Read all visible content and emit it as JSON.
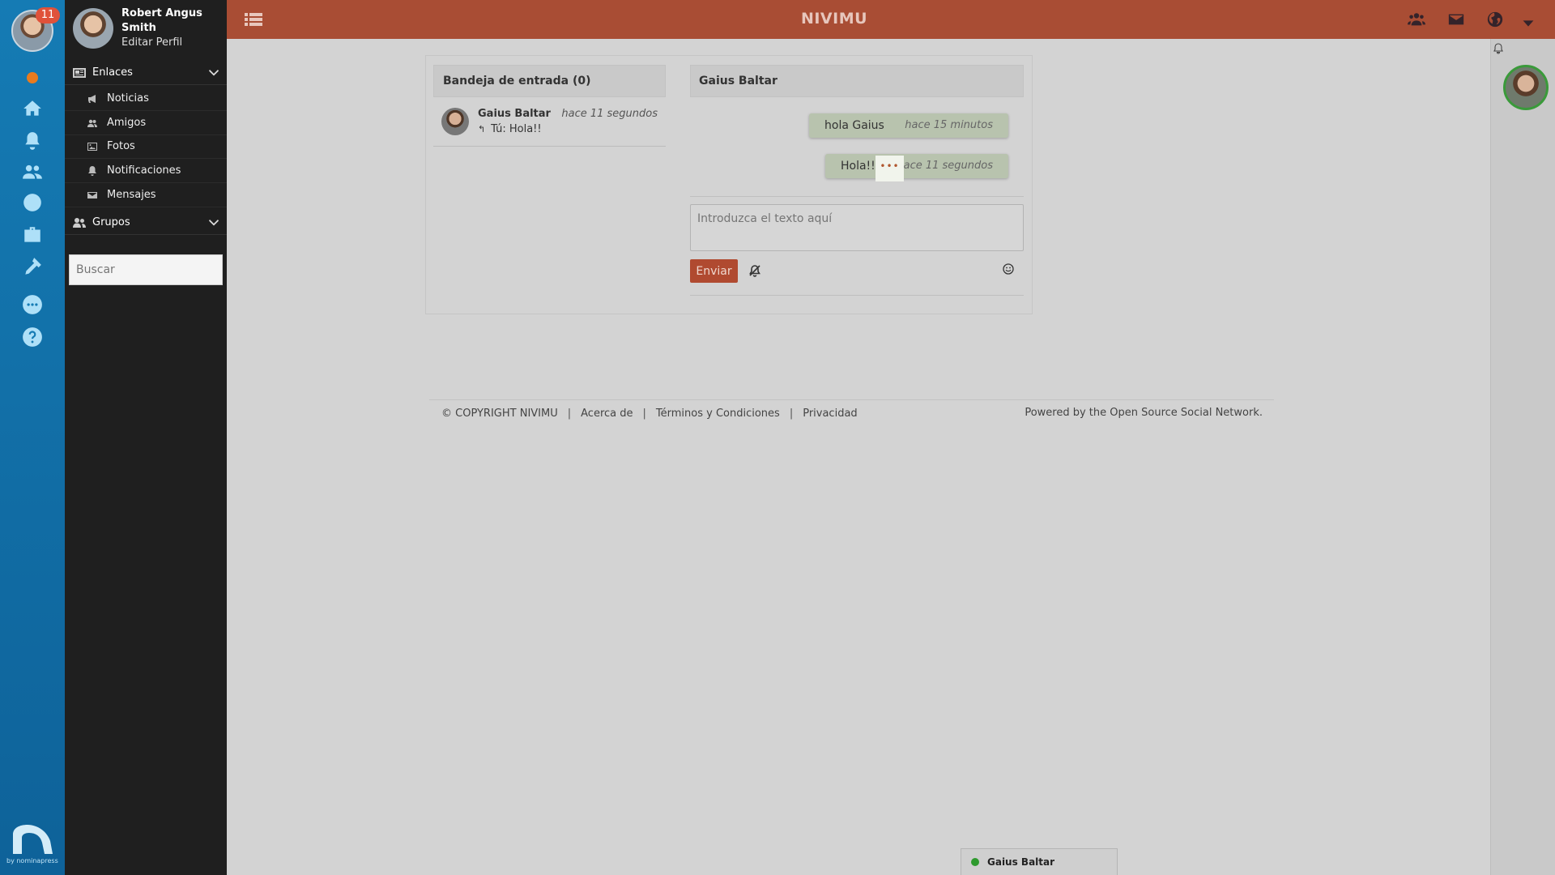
{
  "app": {
    "title": "NIVIMU"
  },
  "rail": {
    "notification_count": "11",
    "brand_by": "by nominapress"
  },
  "user": {
    "name": "Robert Angus Smith",
    "edit_profile": "Editar Perfil"
  },
  "sidebar": {
    "links_section": "Enlaces",
    "items": [
      {
        "label": "Noticias",
        "icon": "megaphone-icon"
      },
      {
        "label": "Amigos",
        "icon": "users-icon"
      },
      {
        "label": "Fotos",
        "icon": "image-icon"
      },
      {
        "label": "Notificaciones",
        "icon": "bell-icon"
      },
      {
        "label": "Mensajes",
        "icon": "envelope-icon"
      }
    ],
    "groups_section": "Grupos",
    "search_placeholder": "Buscar"
  },
  "inbox": {
    "title": "Bandeja de entrada (0)",
    "conversations": [
      {
        "name": "Gaius Baltar",
        "time": "hace 11 segundos",
        "preview": "Tú: Hola!!"
      }
    ]
  },
  "chat": {
    "contact": "Gaius Baltar",
    "messages": [
      {
        "text": "hola Gaius",
        "time": "hace 15 minutos"
      },
      {
        "text": "Hola!!",
        "time": "hace 11 segundos"
      }
    ],
    "options_glyph": "•••",
    "input_placeholder": "Introduzca el texto aquí",
    "send_label": "Enviar"
  },
  "footer": {
    "copyright": "© COPYRIGHT NIVIMU",
    "links": [
      "Acerca de",
      "Términos y Condiciones",
      "Privacidad"
    ],
    "powered": "Powered by the Open Source Social Network."
  },
  "dock": {
    "contact": "Gaius Baltar",
    "status_color": "#2e9a2e"
  },
  "colors": {
    "topbar": "#a94d34",
    "rail": "#157bb4",
    "sidebar": "#1f1f1f",
    "accent": "#b04a30"
  }
}
